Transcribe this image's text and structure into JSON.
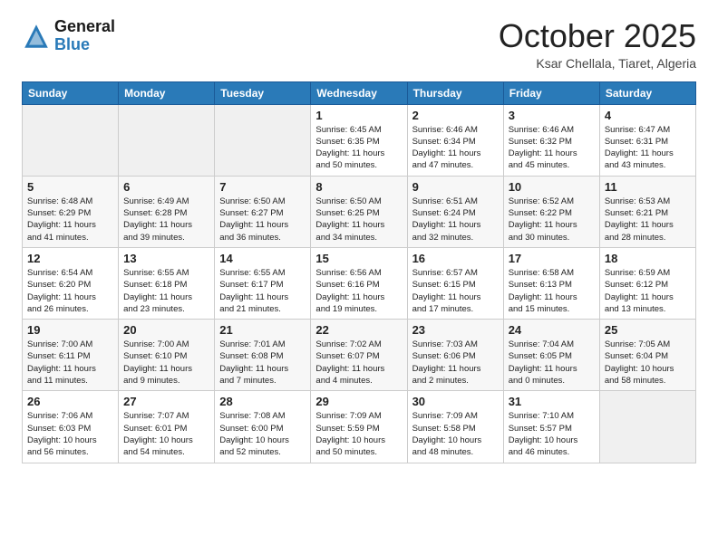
{
  "header": {
    "logo_general": "General",
    "logo_blue": "Blue",
    "month": "October 2025",
    "location": "Ksar Chellala, Tiaret, Algeria"
  },
  "days_of_week": [
    "Sunday",
    "Monday",
    "Tuesday",
    "Wednesday",
    "Thursday",
    "Friday",
    "Saturday"
  ],
  "weeks": [
    [
      {
        "day": "",
        "empty": true
      },
      {
        "day": "",
        "empty": true
      },
      {
        "day": "",
        "empty": true
      },
      {
        "day": "1",
        "line1": "Sunrise: 6:45 AM",
        "line2": "Sunset: 6:35 PM",
        "line3": "Daylight: 11 hours",
        "line4": "and 50 minutes."
      },
      {
        "day": "2",
        "line1": "Sunrise: 6:46 AM",
        "line2": "Sunset: 6:34 PM",
        "line3": "Daylight: 11 hours",
        "line4": "and 47 minutes."
      },
      {
        "day": "3",
        "line1": "Sunrise: 6:46 AM",
        "line2": "Sunset: 6:32 PM",
        "line3": "Daylight: 11 hours",
        "line4": "and 45 minutes."
      },
      {
        "day": "4",
        "line1": "Sunrise: 6:47 AM",
        "line2": "Sunset: 6:31 PM",
        "line3": "Daylight: 11 hours",
        "line4": "and 43 minutes."
      }
    ],
    [
      {
        "day": "5",
        "line1": "Sunrise: 6:48 AM",
        "line2": "Sunset: 6:29 PM",
        "line3": "Daylight: 11 hours",
        "line4": "and 41 minutes."
      },
      {
        "day": "6",
        "line1": "Sunrise: 6:49 AM",
        "line2": "Sunset: 6:28 PM",
        "line3": "Daylight: 11 hours",
        "line4": "and 39 minutes."
      },
      {
        "day": "7",
        "line1": "Sunrise: 6:50 AM",
        "line2": "Sunset: 6:27 PM",
        "line3": "Daylight: 11 hours",
        "line4": "and 36 minutes."
      },
      {
        "day": "8",
        "line1": "Sunrise: 6:50 AM",
        "line2": "Sunset: 6:25 PM",
        "line3": "Daylight: 11 hours",
        "line4": "and 34 minutes."
      },
      {
        "day": "9",
        "line1": "Sunrise: 6:51 AM",
        "line2": "Sunset: 6:24 PM",
        "line3": "Daylight: 11 hours",
        "line4": "and 32 minutes."
      },
      {
        "day": "10",
        "line1": "Sunrise: 6:52 AM",
        "line2": "Sunset: 6:22 PM",
        "line3": "Daylight: 11 hours",
        "line4": "and 30 minutes."
      },
      {
        "day": "11",
        "line1": "Sunrise: 6:53 AM",
        "line2": "Sunset: 6:21 PM",
        "line3": "Daylight: 11 hours",
        "line4": "and 28 minutes."
      }
    ],
    [
      {
        "day": "12",
        "line1": "Sunrise: 6:54 AM",
        "line2": "Sunset: 6:20 PM",
        "line3": "Daylight: 11 hours",
        "line4": "and 26 minutes."
      },
      {
        "day": "13",
        "line1": "Sunrise: 6:55 AM",
        "line2": "Sunset: 6:18 PM",
        "line3": "Daylight: 11 hours",
        "line4": "and 23 minutes."
      },
      {
        "day": "14",
        "line1": "Sunrise: 6:55 AM",
        "line2": "Sunset: 6:17 PM",
        "line3": "Daylight: 11 hours",
        "line4": "and 21 minutes."
      },
      {
        "day": "15",
        "line1": "Sunrise: 6:56 AM",
        "line2": "Sunset: 6:16 PM",
        "line3": "Daylight: 11 hours",
        "line4": "and 19 minutes."
      },
      {
        "day": "16",
        "line1": "Sunrise: 6:57 AM",
        "line2": "Sunset: 6:15 PM",
        "line3": "Daylight: 11 hours",
        "line4": "and 17 minutes."
      },
      {
        "day": "17",
        "line1": "Sunrise: 6:58 AM",
        "line2": "Sunset: 6:13 PM",
        "line3": "Daylight: 11 hours",
        "line4": "and 15 minutes."
      },
      {
        "day": "18",
        "line1": "Sunrise: 6:59 AM",
        "line2": "Sunset: 6:12 PM",
        "line3": "Daylight: 11 hours",
        "line4": "and 13 minutes."
      }
    ],
    [
      {
        "day": "19",
        "line1": "Sunrise: 7:00 AM",
        "line2": "Sunset: 6:11 PM",
        "line3": "Daylight: 11 hours",
        "line4": "and 11 minutes."
      },
      {
        "day": "20",
        "line1": "Sunrise: 7:00 AM",
        "line2": "Sunset: 6:10 PM",
        "line3": "Daylight: 11 hours",
        "line4": "and 9 minutes."
      },
      {
        "day": "21",
        "line1": "Sunrise: 7:01 AM",
        "line2": "Sunset: 6:08 PM",
        "line3": "Daylight: 11 hours",
        "line4": "and 7 minutes."
      },
      {
        "day": "22",
        "line1": "Sunrise: 7:02 AM",
        "line2": "Sunset: 6:07 PM",
        "line3": "Daylight: 11 hours",
        "line4": "and 4 minutes."
      },
      {
        "day": "23",
        "line1": "Sunrise: 7:03 AM",
        "line2": "Sunset: 6:06 PM",
        "line3": "Daylight: 11 hours",
        "line4": "and 2 minutes."
      },
      {
        "day": "24",
        "line1": "Sunrise: 7:04 AM",
        "line2": "Sunset: 6:05 PM",
        "line3": "Daylight: 11 hours",
        "line4": "and 0 minutes."
      },
      {
        "day": "25",
        "line1": "Sunrise: 7:05 AM",
        "line2": "Sunset: 6:04 PM",
        "line3": "Daylight: 10 hours",
        "line4": "and 58 minutes."
      }
    ],
    [
      {
        "day": "26",
        "line1": "Sunrise: 7:06 AM",
        "line2": "Sunset: 6:03 PM",
        "line3": "Daylight: 10 hours",
        "line4": "and 56 minutes."
      },
      {
        "day": "27",
        "line1": "Sunrise: 7:07 AM",
        "line2": "Sunset: 6:01 PM",
        "line3": "Daylight: 10 hours",
        "line4": "and 54 minutes."
      },
      {
        "day": "28",
        "line1": "Sunrise: 7:08 AM",
        "line2": "Sunset: 6:00 PM",
        "line3": "Daylight: 10 hours",
        "line4": "and 52 minutes."
      },
      {
        "day": "29",
        "line1": "Sunrise: 7:09 AM",
        "line2": "Sunset: 5:59 PM",
        "line3": "Daylight: 10 hours",
        "line4": "and 50 minutes."
      },
      {
        "day": "30",
        "line1": "Sunrise: 7:09 AM",
        "line2": "Sunset: 5:58 PM",
        "line3": "Daylight: 10 hours",
        "line4": "and 48 minutes."
      },
      {
        "day": "31",
        "line1": "Sunrise: 7:10 AM",
        "line2": "Sunset: 5:57 PM",
        "line3": "Daylight: 10 hours",
        "line4": "and 46 minutes."
      },
      {
        "day": "",
        "empty": true
      }
    ]
  ]
}
